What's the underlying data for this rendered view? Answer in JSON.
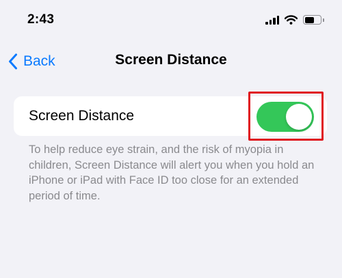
{
  "status_bar": {
    "time": "2:43",
    "icons": [
      "cellular-signal-icon",
      "wifi-icon",
      "battery-icon"
    ]
  },
  "nav": {
    "back_label": "Back",
    "title": "Screen Distance"
  },
  "setting": {
    "label": "Screen Distance",
    "toggle_on": true,
    "footnote": "To help reduce eye strain, and the risk of myopia in children, Screen Distance will alert you when you hold an iPhone or iPad with Face ID too close for an extended period of time."
  },
  "colors": {
    "accent": "#0a7aff",
    "toggle_on": "#34c759",
    "highlight_box": "#e0151e",
    "background": "#f2f2f7"
  }
}
